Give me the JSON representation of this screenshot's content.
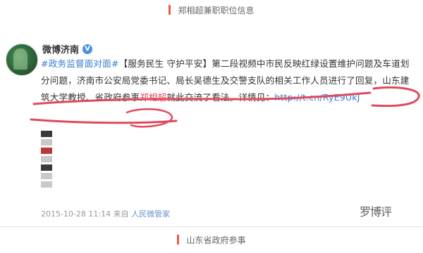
{
  "header": {
    "caption": "郑相超兼职职位信息"
  },
  "post": {
    "author": "微博济南",
    "verified_icon": "verified-badge-icon",
    "content": {
      "topic": "#政务监督面对面#",
      "segment1": "【服务民生 守护平安】第二段视频中市民反映红绿设置维护问题及车道划分问题，济南市公安局党委书记、局长吴德生及交警支队的相关工作人员进行了回复，山东建筑大学教授、省政府参事",
      "highlight": "郑相超",
      "segment2": "就此交流了看法。详情见：",
      "link": "http://t.cn/RyE9UkJ"
    },
    "meta": {
      "timestamp": "2015-10-28 11:14",
      "source_prefix": "来自",
      "source": "人民微管家"
    }
  },
  "watermark": "罗博评",
  "footer": {
    "caption": "山东省政府参事"
  },
  "colors": {
    "accent": "#e85b4a",
    "link": "#3b7bd4",
    "ink": "#e0495c"
  }
}
